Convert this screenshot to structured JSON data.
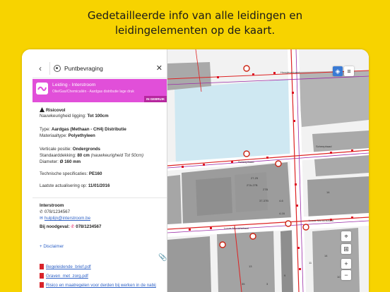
{
  "headline": {
    "line1": "Gedetailleerde info van alle leidingen en",
    "line2": "leidingelementen op de kaart."
  },
  "panel": {
    "title": "Puntbevraging",
    "back_icon": "chevron-left-icon",
    "close_icon": "close-icon",
    "card": {
      "title": "Leiding - Interstroom",
      "subtitle": "Olie/Gas/Chemicaliën - Aardgas distributie lage druk",
      "badge": "IN GEBRUIK",
      "color": "#e14fd9"
    },
    "details": {
      "risk": "Risicovol",
      "accuracy_label": "Nauwkeurigheid ligging:",
      "accuracy_value": "Tot 100cm",
      "type_label": "Type:",
      "type_value": "Aardgas (Methaan - CH4) Distributie",
      "material_label": "Materiaaltype:",
      "material_value": "Polyethyleen",
      "vertical_label": "Verticale positie:",
      "vertical_value": "Ondergronds",
      "cover_label": "Standaarddekking:",
      "cover_value": "80 cm",
      "cover_accuracy": "(nauwkeurigheid Tot 50cm)",
      "diameter_label": "Diameter:",
      "diameter_value": "Ø 160 mm",
      "tech_label": "Technische specificaties:",
      "tech_value": "PE160",
      "update_label": "Laatste actualisering op:",
      "update_value": "11/01/2016"
    },
    "contact": {
      "name": "Interstroom",
      "phone": "078/1234567",
      "email": "hulplijn@interstroom.be",
      "emergency_label": "Bij noodgeval:",
      "emergency_phone": "078/1234567"
    },
    "disclaimer": "+ Disclaimer",
    "files": [
      "Begeleidende_brief.pdf",
      "Graven_met_zorg.pdf",
      "Risico en maatregelen voor derden bij werken in de nabij"
    ]
  },
  "map": {
    "street_labels": [
      "Hoogleverbaad",
      "Scheepbaad",
      "Scheepbaad",
      "Lucas Munichstraat",
      "Lucas Munichstraat"
    ],
    "building_numbers": [
      "27A-27B",
      "27B",
      "37-37B",
      "4-6",
      "14",
      "4-16",
      "27-25",
      "35",
      "3",
      "9",
      "11",
      "14",
      "10",
      "13"
    ],
    "controls": {
      "layers_icon": "layers-icon",
      "menu_icon": "menu-icon",
      "zoom_in": "+",
      "zoom_out": "−",
      "locate_icon": "locate-icon",
      "measure_icon": "measure-icon"
    }
  }
}
